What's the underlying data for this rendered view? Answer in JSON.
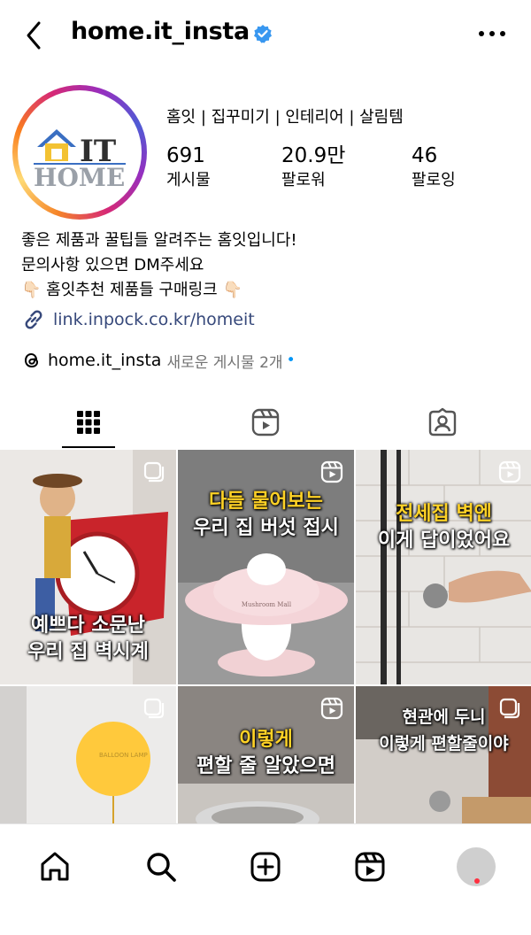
{
  "header": {
    "username": "home.it_insta",
    "back_icon": "chevron-left-icon",
    "verified_icon": "verified-badge-icon",
    "more_icon": "more-horizontal-icon"
  },
  "profile": {
    "avatar_logo_text_top": "IT",
    "avatar_logo_text_bottom": "HOME",
    "category": "홈잇 | 집꾸미기 | 인테리어 | 살림템",
    "stats": [
      {
        "value": "691",
        "label": "게시물"
      },
      {
        "value": "20.9만",
        "label": "팔로워"
      },
      {
        "value": "46",
        "label": "팔로잉"
      }
    ],
    "bio": [
      "좋은 제품과 꿀팁들 알려주는 홈잇입니다!",
      "문의사항 있으면 DM주세요",
      "👇🏻 홈잇추천 제품들 구매링크 👇🏻"
    ],
    "link": "link.inpock.co.kr/homeit",
    "threads_name": "home.it_insta",
    "threads_new": "새로운 게시물 2개",
    "threads_dot": "•"
  },
  "tabs": [
    {
      "icon": "grid-icon",
      "active": true
    },
    {
      "icon": "reels-icon",
      "active": false
    },
    {
      "icon": "tagged-icon",
      "active": false
    }
  ],
  "posts": [
    {
      "caption_1": "예쁘다 소문난",
      "caption_2": "우리 집 벽시계",
      "badge": "carousel-icon"
    },
    {
      "caption_1": "다들 물어보는",
      "caption_2": "우리 집 버섯 접시",
      "badge": "reels-icon",
      "plate_text": "Mushroom Mall"
    },
    {
      "caption_1": "전세집 벽엔",
      "caption_2": "이게 답이었어요",
      "badge": "reels-icon"
    },
    {
      "caption_1": "",
      "caption_2": "",
      "badge": "carousel-icon",
      "balloon_text": "BALLOON LAMP"
    },
    {
      "caption_1": "이렇게",
      "caption_2": "편할 줄 알았으면",
      "badge": "reels-icon"
    },
    {
      "caption_1": "현관에 두니",
      "caption_2": "이렇게 편할줄이야",
      "badge": "carousel-icon"
    }
  ],
  "bottom_nav": [
    {
      "icon": "home-icon"
    },
    {
      "icon": "search-icon"
    },
    {
      "icon": "create-icon"
    },
    {
      "icon": "reels-icon"
    },
    {
      "icon": "profile-avatar"
    }
  ],
  "colors": {
    "link": "#37497b",
    "verified": "#3897f0",
    "highlight_caption": "#ffd226",
    "notification_dot": "#ff3040"
  }
}
